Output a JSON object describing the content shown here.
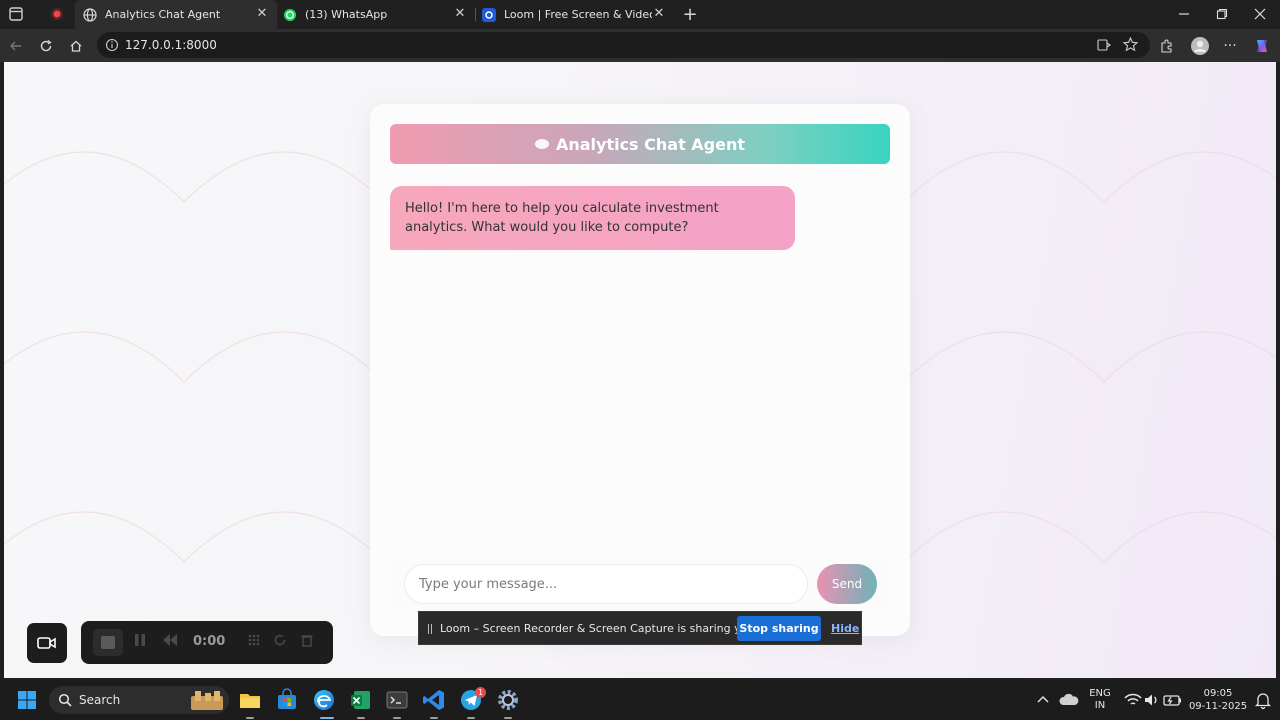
{
  "browser": {
    "tabs": [
      {
        "label": "Analytics Chat Agent",
        "active": true
      },
      {
        "label": "(13) WhatsApp",
        "active": false
      },
      {
        "label": "Loom | Free Screen & Video Reco",
        "active": false
      }
    ],
    "url": "127.0.0.1:8000"
  },
  "app": {
    "header_title": "Analytics Chat Agent",
    "messages": [
      {
        "role": "agent",
        "text": "Hello! I'm here to help you calculate investment analytics. What would you like to compute?"
      }
    ],
    "input_placeholder": "Type your message...",
    "send_label": "Send"
  },
  "loom": {
    "timer": "0:00",
    "share_text": "Loom – Screen Recorder & Screen Capture is sharing your screen.",
    "stop_label": "Stop sharing",
    "hide_label": "Hide"
  },
  "taskbar": {
    "search_label": "Search",
    "telegram_badge": "1",
    "lang_line1": "ENG",
    "lang_line2": "IN",
    "time": "09:05",
    "date": "09-11-2025"
  },
  "colors": {
    "header_gradient_start": "#f09bb0",
    "header_gradient_end": "#38d4c1",
    "bubble_pink": "#f7a7bb",
    "stop_button_blue": "#1a6fd6"
  }
}
